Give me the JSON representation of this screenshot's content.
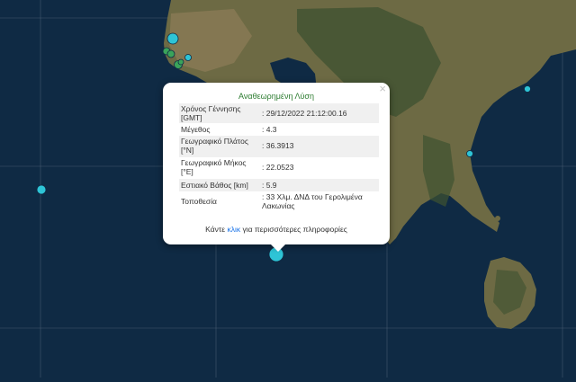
{
  "map": {
    "colors": {
      "sea": "#0f2a44",
      "land": "#6d6a44",
      "land_dark": "#3e5230",
      "land_light": "#8e7e58",
      "grid": "#6b7c8c",
      "quake_cyan": "#2ec4d6",
      "quake_green": "#3aa35a"
    },
    "marker_icon": "earthquake-circle-icon"
  },
  "popup": {
    "title": "Αναθεωρημένη Λύση",
    "close_label": "×",
    "fields": [
      {
        "label": "Χρόνος Γέννησης [GMT]",
        "value": ": 29/12/2022 21:12:00.16"
      },
      {
        "label": "Μέγεθος",
        "value": ": 4.3"
      },
      {
        "label": "Γεωγραφικό Πλάτος [°N]",
        "value": ": 36.3913"
      },
      {
        "label": "Γεωγραφικό Μήκος [°E]",
        "value": ": 22.0523"
      },
      {
        "label": "Εστιακό Βάθος [km]",
        "value": ": 5.9"
      },
      {
        "label": "Τοποθεσία",
        "value": ": 33 Χλμ. ΔΝΔ του Γερολιμένα Λακωνίας"
      }
    ],
    "more_prefix": "Κάντε",
    "more_link": "κλικ",
    "more_suffix": "για περισσότερες πληροφορίες"
  }
}
